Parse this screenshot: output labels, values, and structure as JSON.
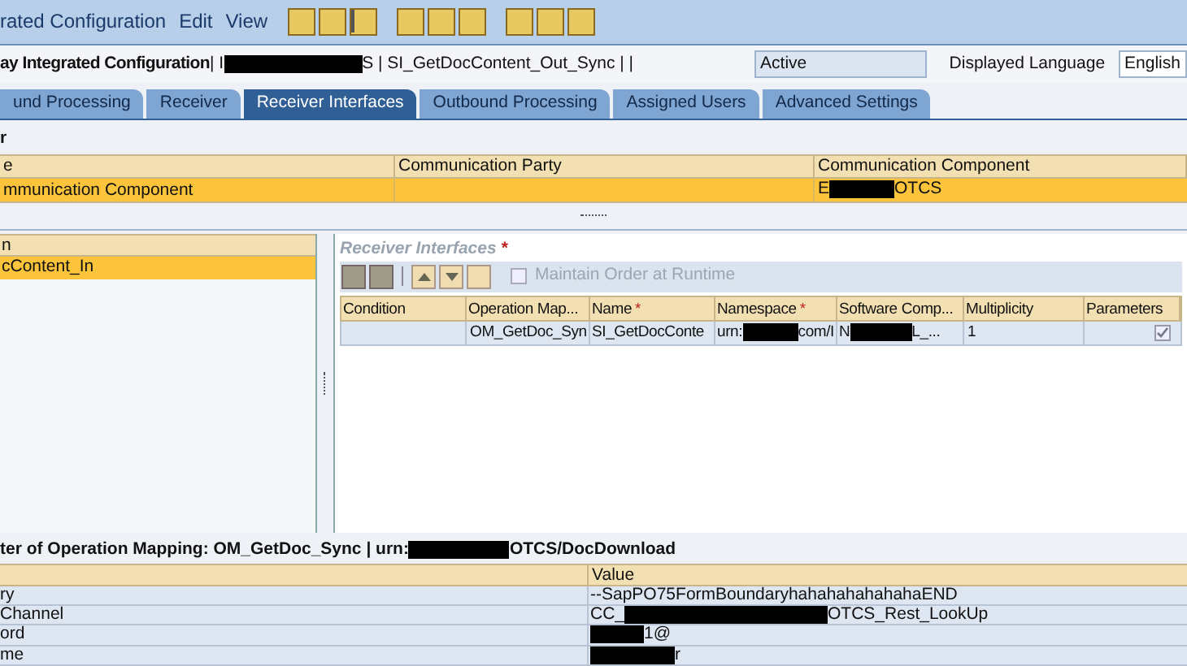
{
  "menu_bar": {
    "title": "rated Configuration",
    "menus": [
      "Edit",
      "View"
    ]
  },
  "header": {
    "title": "ay Integrated Configuration",
    "object": {
      "before": "| I",
      "after": "S | SI_GetDocContent_Out_Sync | |"
    },
    "status": "Active",
    "language_label": "Displayed Language",
    "language": "English"
  },
  "tabs": [
    {
      "label": "und Processing",
      "selected": false
    },
    {
      "label": "Receiver",
      "selected": false
    },
    {
      "label": "Receiver Interfaces",
      "selected": true
    },
    {
      "label": "Outbound Processing",
      "selected": false
    },
    {
      "label": "Assigned Users",
      "selected": false
    },
    {
      "label": "Advanced Settings",
      "selected": false
    }
  ],
  "receiver": {
    "title": "r",
    "columns": [
      "e",
      "Communication Party",
      "Communication Component"
    ],
    "rows": [
      {
        "selected": true,
        "type": "mmunication Component",
        "party": "",
        "component": {
          "before": "E",
          "after": "OTCS"
        }
      }
    ]
  },
  "left_list": {
    "header": "n",
    "rows": [
      {
        "label": "cContent_In",
        "selected": true
      }
    ]
  },
  "interfaces": {
    "title": "Receiver Interfaces",
    "required_mark": "*",
    "maintain_order": {
      "label": "Maintain Order at Runtime",
      "checked": false,
      "disabled": true
    },
    "columns": [
      {
        "label": "Condition"
      },
      {
        "label": "Operation Map...",
        "required": false
      },
      {
        "label": "Name",
        "required": true
      },
      {
        "label": "Namespace",
        "required": true
      },
      {
        "label": "Software Comp..."
      },
      {
        "label": "Multiplicity"
      },
      {
        "label": "Parameters"
      }
    ],
    "rows": [
      {
        "condition": "",
        "operation_mapping": "OM_GetDoc_Syn",
        "name": "SI_GetDocConte",
        "namespace": {
          "before": "urn:",
          "after": "com/I"
        },
        "software_component": {
          "before": "N",
          "after": "L_..."
        },
        "multiplicity": "1",
        "parameters": true
      }
    ]
  },
  "parameters": {
    "title": {
      "before": "ter of Operation Mapping: OM_GetDoc_Sync | urn:",
      "after": "OTCS/DocDownload"
    },
    "columns": [
      "Value"
    ],
    "rows": [
      {
        "name": "ry",
        "value": {
          "before": "--SapPO75FormBoundaryhahahahahahahaEND",
          "redacted": false
        }
      },
      {
        "name": "Channel",
        "value": {
          "before": "CC_",
          "redacted": true,
          "after": "OTCS_Rest_LookUp"
        }
      },
      {
        "name": "ord",
        "value": {
          "redacted": true,
          "after": "1@"
        }
      },
      {
        "name": "me",
        "value": {
          "redacted": true,
          "after": "r"
        }
      }
    ]
  }
}
